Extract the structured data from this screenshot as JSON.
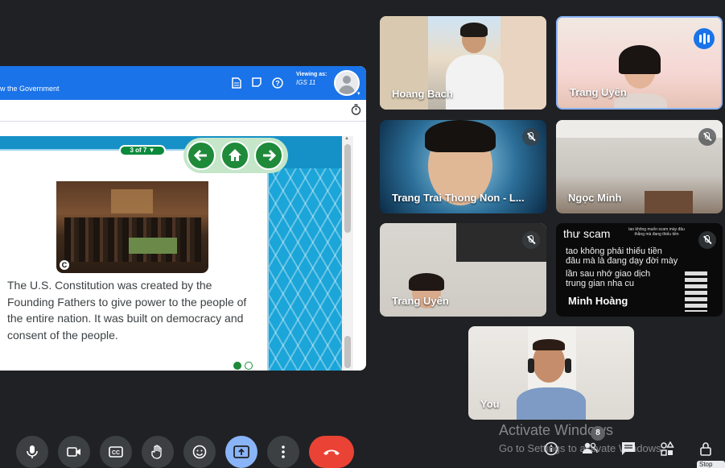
{
  "presentation": {
    "title": "w the Government",
    "viewing_as_label": "Viewing as:",
    "viewing_as_value": "IGS 11",
    "page_indicator": "3 of 7 ▼",
    "slide_text": "The U.S. Constitution was created by the Founding Fathers to give power to the people of the entire nation. It was built on democracy and consent of the people.",
    "copyright_glyph": "C",
    "icons": [
      "document-icon",
      "sticky-note-icon",
      "help-icon",
      "timer-icon",
      "user-avatar-icon",
      "arrow-left-icon",
      "home-icon",
      "arrow-right-icon"
    ],
    "accent": "#1a73e8",
    "nav_color": "#1e8a3a"
  },
  "participants": [
    {
      "name": "Hoang Bach",
      "muted": false,
      "speaking": false
    },
    {
      "name": "Trang Uyên",
      "muted": false,
      "speaking": true
    },
    {
      "name": "Trang Trai Thong Non - L...",
      "muted": true,
      "speaking": false
    },
    {
      "name": "Ngọc Minh",
      "muted": true,
      "speaking": false
    },
    {
      "name": "Trang Uyên",
      "muted": true,
      "speaking": false
    },
    {
      "name": "Minh Hoàng",
      "muted": true,
      "speaking": false
    },
    {
      "name": "You",
      "muted": false,
      "speaking": false
    }
  ],
  "minh_hoang_overlay": {
    "line1": "thư scam",
    "line1_small": "tao không muốn scam mày đâu thằng mà đang thiếu tiền",
    "line2": "tao không phải thiếu tiền",
    "line3": "đâu mà là đang dạy đời mày",
    "line4": "lần sau nhớ giao dịch",
    "line5": "trung gian nha cu"
  },
  "controls": {
    "buttons": [
      "mic-icon",
      "camera-icon",
      "captions-icon",
      "raise-hand-icon",
      "emoji-icon",
      "present-icon",
      "more-icon",
      "end-call-icon"
    ],
    "participants_count": "8",
    "right_icons": [
      "info-icon",
      "people-icon",
      "chat-icon",
      "activities-icon",
      "lock-icon"
    ],
    "tooltip": "Stop"
  },
  "watermark": {
    "line1": "Activate Windows",
    "line2": "Go to Settings to activate Windows."
  },
  "colors": {
    "background": "#202124",
    "end_call": "#ea4335",
    "present_active": "#8ab4f8"
  }
}
